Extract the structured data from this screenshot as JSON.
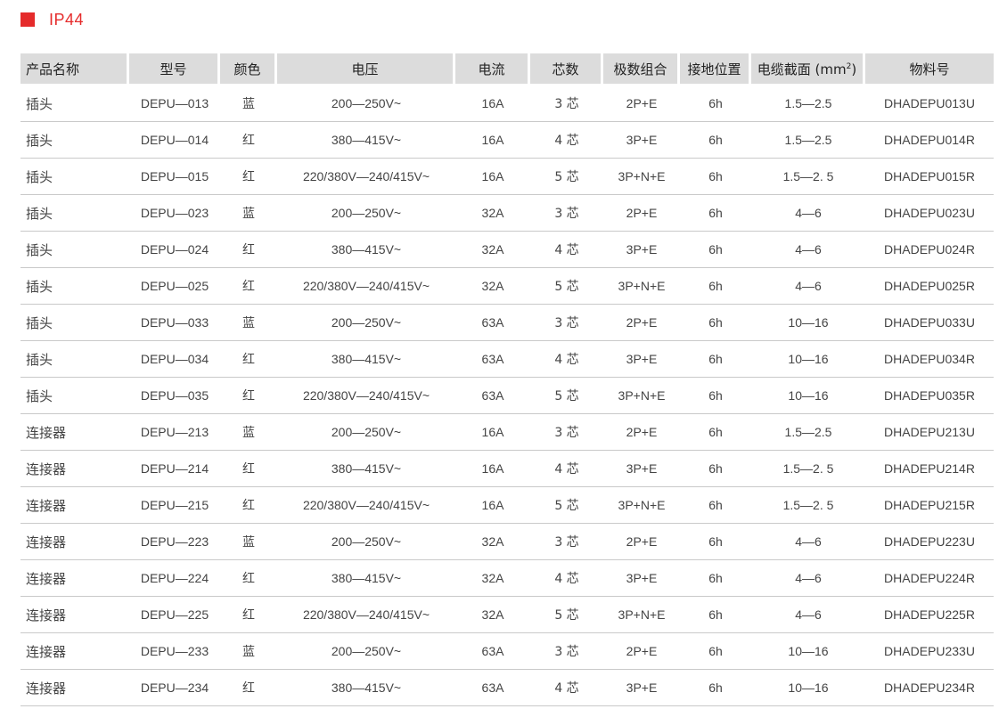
{
  "title": "IP44",
  "headers": [
    "产品名称",
    "型号",
    "颜色",
    "电压",
    "电流",
    "芯数",
    "极数组合",
    "接地位置",
    "电缆截面 (mm",
    "物料号"
  ],
  "header_sup": "2",
  "header_close": ")",
  "rows": [
    [
      "插头",
      "DEPU—013",
      "蓝",
      "200—250V~",
      "16A",
      "3 芯",
      "2P+E",
      "6h",
      "1.5—2.5",
      "DHADEPU013U"
    ],
    [
      "插头",
      "DEPU—014",
      "红",
      "380—415V~",
      "16A",
      "4 芯",
      "3P+E",
      "6h",
      "1.5—2.5",
      "DHADEPU014R"
    ],
    [
      "插头",
      "DEPU—015",
      "红",
      "220/380V—240/415V~",
      "16A",
      "5 芯",
      "3P+N+E",
      "6h",
      "1.5—2. 5",
      "DHADEPU015R"
    ],
    [
      "插头",
      "DEPU—023",
      "蓝",
      "200—250V~",
      "32A",
      "3 芯",
      "2P+E",
      "6h",
      "4—6",
      "DHADEPU023U"
    ],
    [
      "插头",
      "DEPU—024",
      "红",
      "380—415V~",
      "32A",
      "4 芯",
      "3P+E",
      "6h",
      "4—6",
      "DHADEPU024R"
    ],
    [
      "插头",
      "DEPU—025",
      "红",
      "220/380V—240/415V~",
      "32A",
      "5 芯",
      "3P+N+E",
      "6h",
      "4—6",
      "DHADEPU025R"
    ],
    [
      "插头",
      "DEPU—033",
      "蓝",
      "200—250V~",
      "63A",
      "3 芯",
      "2P+E",
      "6h",
      "10—16",
      "DHADEPU033U"
    ],
    [
      "插头",
      "DEPU—034",
      "红",
      "380—415V~",
      "63A",
      "4 芯",
      "3P+E",
      "6h",
      "10—16",
      "DHADEPU034R"
    ],
    [
      "插头",
      "DEPU—035",
      "红",
      "220/380V—240/415V~",
      "63A",
      "5 芯",
      "3P+N+E",
      "6h",
      "10—16",
      "DHADEPU035R"
    ],
    [
      "连接器",
      "DEPU—213",
      "蓝",
      "200—250V~",
      "16A",
      "3 芯",
      "2P+E",
      "6h",
      "1.5—2.5",
      "DHADEPU213U"
    ],
    [
      "连接器",
      "DEPU—214",
      "红",
      "380—415V~",
      "16A",
      "4 芯",
      "3P+E",
      "6h",
      "1.5—2. 5",
      "DHADEPU214R"
    ],
    [
      "连接器",
      "DEPU—215",
      "红",
      "220/380V—240/415V~",
      "16A",
      "5 芯",
      "3P+N+E",
      "6h",
      "1.5—2. 5",
      "DHADEPU215R"
    ],
    [
      "连接器",
      "DEPU—223",
      "蓝",
      "200—250V~",
      "32A",
      "3 芯",
      "2P+E",
      "6h",
      "4—6",
      "DHADEPU223U"
    ],
    [
      "连接器",
      "DEPU—224",
      "红",
      "380—415V~",
      "32A",
      "4 芯",
      "3P+E",
      "6h",
      "4—6",
      "DHADEPU224R"
    ],
    [
      "连接器",
      "DEPU—225",
      "红",
      "220/380V—240/415V~",
      "32A",
      "5 芯",
      "3P+N+E",
      "6h",
      "4—6",
      "DHADEPU225R"
    ],
    [
      "连接器",
      "DEPU—233",
      "蓝",
      "200—250V~",
      "63A",
      "3 芯",
      "2P+E",
      "6h",
      "10—16",
      "DHADEPU233U"
    ],
    [
      "连接器",
      "DEPU—234",
      "红",
      "380—415V~",
      "63A",
      "4 芯",
      "3P+E",
      "6h",
      "10—16",
      "DHADEPU234R"
    ]
  ],
  "colors": {
    "accent": "#e52b2b",
    "header_bg": "#dcdcdc",
    "row_border": "#c9c9c9"
  }
}
